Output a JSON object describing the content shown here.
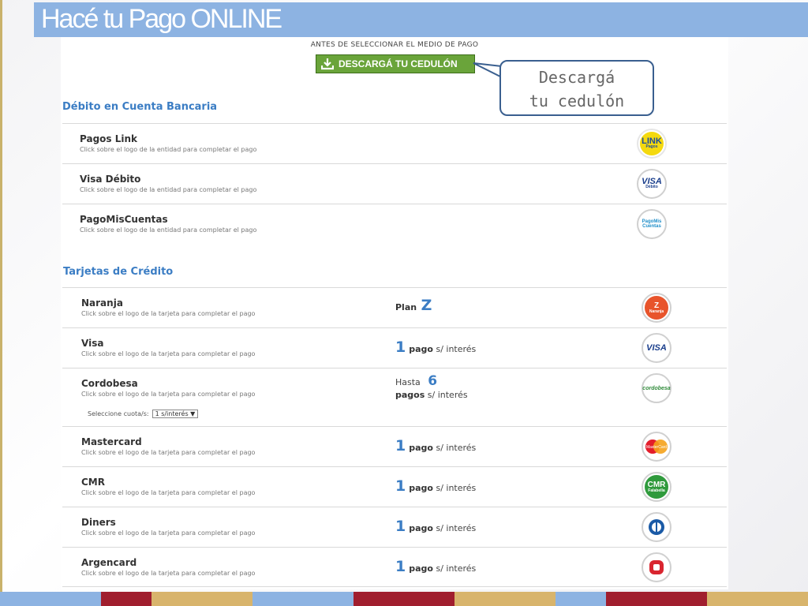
{
  "slide": {
    "title": "Hacé tu Pago ONLINE"
  },
  "header": {
    "pre_label": "ANTES DE SELECCIONAR EL MEDIO DE PAGO",
    "download_button": "DESCARGÁ TU CEDULÓN"
  },
  "callout": {
    "line1": "Descargá",
    "line2": "tu cedulón"
  },
  "debit": {
    "title": "Débito en Cuenta Bancaria",
    "items": [
      {
        "name": "Pagos Link",
        "hint": "Click sobre el logo de la entidad para completar el pago",
        "logo": "LINK",
        "logo_sub": "Pagos"
      },
      {
        "name": "Visa Débito",
        "hint": "Click sobre el logo de la entidad para completar el pago",
        "logo": "VISA",
        "logo_sub": "Débito"
      },
      {
        "name": "PagoMisCuentas",
        "hint": "Click sobre el logo de la entidad para completar el pago",
        "logo": "PagoMis Cuentas"
      }
    ]
  },
  "credit": {
    "title": "Tarjetas de Crédito",
    "items": [
      {
        "name": "Naranja",
        "hint": "Click sobre el logo de la tarjeta para completar el pago",
        "promo_prefix": "Plan",
        "promo_big": "Z",
        "logo": "Z",
        "logo_sub": "Naranja"
      },
      {
        "name": "Visa",
        "hint": "Click sobre el logo de la tarjeta para completar el pago",
        "promo_big": "1",
        "promo_bold": "pago",
        "promo_rest": "s/ interés",
        "logo": "VISA"
      },
      {
        "name": "Cordobesa",
        "hint": "Click sobre el logo de la tarjeta para completar el pago",
        "promo_prefix": "Hasta",
        "promo_big": "6",
        "promo_bold": "pagos",
        "promo_rest": "s/ interés",
        "logo": "cordobesa",
        "select_label": "Seleccione cuota/s:",
        "select_value": "1 s/interés ▼"
      },
      {
        "name": "Mastercard",
        "hint": "Click sobre el logo de la tarjeta para completar el pago",
        "promo_big": "1",
        "promo_bold": "pago",
        "promo_rest": "s/ interés",
        "logo": "MasterCard"
      },
      {
        "name": "CMR",
        "hint": "Click sobre el logo de la tarjeta para completar el pago",
        "promo_big": "1",
        "promo_bold": "pago",
        "promo_rest": "s/ interés",
        "logo": "CMR",
        "logo_sub": "Falabella"
      },
      {
        "name": "Diners",
        "hint": "Click sobre el logo de la tarjeta para completar el pago",
        "promo_big": "1",
        "promo_bold": "pago",
        "promo_rest": "s/ interés",
        "logo": "diners-logo"
      },
      {
        "name": "Argencard",
        "hint": "Click sobre el logo de la tarjeta para completar el pago",
        "promo_big": "1",
        "promo_bold": "pago",
        "promo_rest": "s/ interés",
        "logo": "argencard-logo"
      }
    ]
  },
  "colors": {
    "title_bar": "#8db3e2",
    "accent_blue": "#3b7dc4",
    "download_green": "#6aa43a",
    "naranja": "#e8542b",
    "cmr_green": "#2f9a3c",
    "argencard_red": "#d9252f"
  }
}
